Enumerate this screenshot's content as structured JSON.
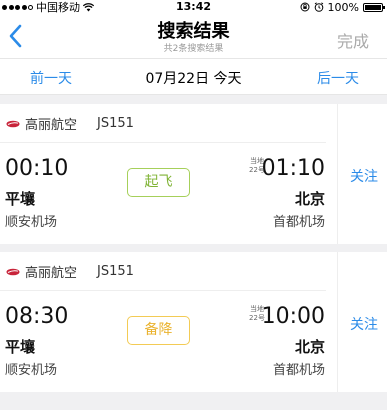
{
  "status_bar": {
    "carrier": "中国移动",
    "time": "13:42",
    "battery": "100%",
    "signal_bars": 4
  },
  "nav": {
    "title": "搜索结果",
    "subtitle": "共2条搜索结果",
    "done_label": "完成"
  },
  "date_bar": {
    "prev_label": "前一天",
    "current": "07月22日 今天",
    "next_label": "后一天"
  },
  "flights": [
    {
      "airline": "高丽航空",
      "flight_no": "JS151",
      "dep_time": "00:10",
      "dep_city": "平壤",
      "dep_airport": "顺安机场",
      "local_note_1": "当地",
      "local_note_2": "22号",
      "arr_time": "01:10",
      "arr_city": "北京",
      "arr_airport": "首都机场",
      "status": "起飞",
      "status_color": "#7fb334",
      "follow_label": "关注"
    },
    {
      "airline": "高丽航空",
      "flight_no": "JS151",
      "dep_time": "08:30",
      "dep_city": "平壤",
      "dep_airport": "顺安机场",
      "local_note_1": "当地",
      "local_note_2": "22号",
      "arr_time": "10:00",
      "arr_city": "北京",
      "arr_airport": "首都机场",
      "status": "备降",
      "status_color": "#eab22d",
      "follow_label": "关注"
    }
  ]
}
